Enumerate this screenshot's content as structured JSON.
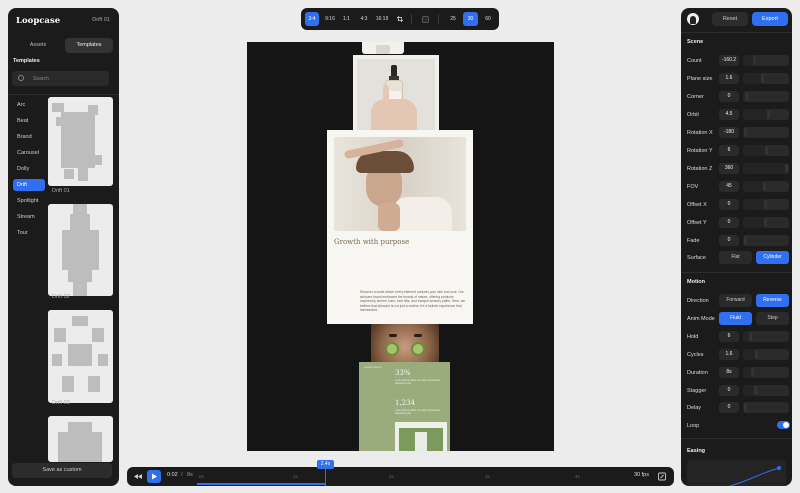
{
  "app": {
    "name": "Loopcase",
    "project": "Drift 01"
  },
  "left": {
    "tabs": [
      "Assets",
      "Templates"
    ],
    "active_tab": "Templates",
    "section": "Templates",
    "search_placeholder": "Search",
    "categories": [
      "Arc",
      "Beat",
      "Brand",
      "Carousel",
      "Dolly",
      "Drift",
      "Spotlight",
      "Stream",
      "Tour"
    ],
    "active_category": "Drift",
    "templates": [
      "Drift 01",
      "Drift 02",
      "Drift 03"
    ],
    "save_label": "Save as custom"
  },
  "topbar": {
    "aspect_ratios": [
      "3:4",
      "9:16",
      "1:1",
      "4:3",
      "16:19"
    ],
    "active_ratio": "3:4",
    "fps_options": [
      "25",
      "30",
      "60"
    ],
    "active_fps": "30",
    "icons": [
      "crop-icon",
      "frame-icon"
    ]
  },
  "canvas": {
    "card_title": "Growth with purpose",
    "card_body": "Discover a world where every element nurtures your skin and soul. Our skincare brand embraces the beauty of nature, offering products inspired by serene hues, lush hills, and tranquil sensory paths. Here, we believe that skincare is not just a routine; it's a holistic experience that harmonizes.",
    "green_label": "Lorem ipsum",
    "stat1": "33%",
    "stat1_note": "Lorem ipsum dolor sit amet consectetur adipiscing elit",
    "stat2": "1,234",
    "stat2_note": "Lorem ipsum dolor sit amet consectetur adipiscing elit"
  },
  "right": {
    "reset_label": "Reset",
    "export_label": "Export",
    "scene_title": "Scene",
    "scene": [
      {
        "label": "Count",
        "value": "-160.2"
      },
      {
        "label": "Plane size",
        "value": "1.6"
      },
      {
        "label": "Corner",
        "value": "0"
      },
      {
        "label": "Orbit",
        "value": "4.5"
      },
      {
        "label": "Rotation X",
        "value": "-180"
      },
      {
        "label": "Rotation Y",
        "value": "6"
      },
      {
        "label": "Rotation Z",
        "value": "360"
      },
      {
        "label": "FOV",
        "value": "45"
      },
      {
        "label": "Offset X",
        "value": "0"
      },
      {
        "label": "Offset Y",
        "value": "0"
      },
      {
        "label": "Fade",
        "value": "0"
      }
    ],
    "surface": {
      "label": "Surface",
      "options": [
        "Flat",
        "Cylinder"
      ],
      "active": "Cylinder"
    },
    "motion_title": "Motion",
    "direction": {
      "label": "Direction",
      "options": [
        "Forward",
        "Reverse"
      ],
      "active": "Reverse"
    },
    "anim_mode": {
      "label": "Anim Mode",
      "options": [
        "Fluid",
        "Step"
      ],
      "active": "Fluid"
    },
    "motion": [
      {
        "label": "Hold",
        "value": "6"
      },
      {
        "label": "Cycles",
        "value": "1.6"
      },
      {
        "label": "Duration",
        "value": "8s"
      },
      {
        "label": "Stagger",
        "value": "0"
      },
      {
        "label": "Delay",
        "value": "0"
      }
    ],
    "loop_label": "Loop",
    "loop_on": true,
    "easing_title": "Easing"
  },
  "timeline": {
    "current": "0:02",
    "separator": "/",
    "total": "8s",
    "marker": "2.4s",
    "ticks": [
      "0s",
      "1s",
      "2s",
      "3s",
      "4s",
      "5s"
    ],
    "fps_label": "30 fps",
    "progress": 0.3
  },
  "colors": {
    "accent": "#2f6ff0",
    "panel": "#1b1b1b",
    "canvas": "#151515",
    "green_card": "#9aab7c"
  }
}
